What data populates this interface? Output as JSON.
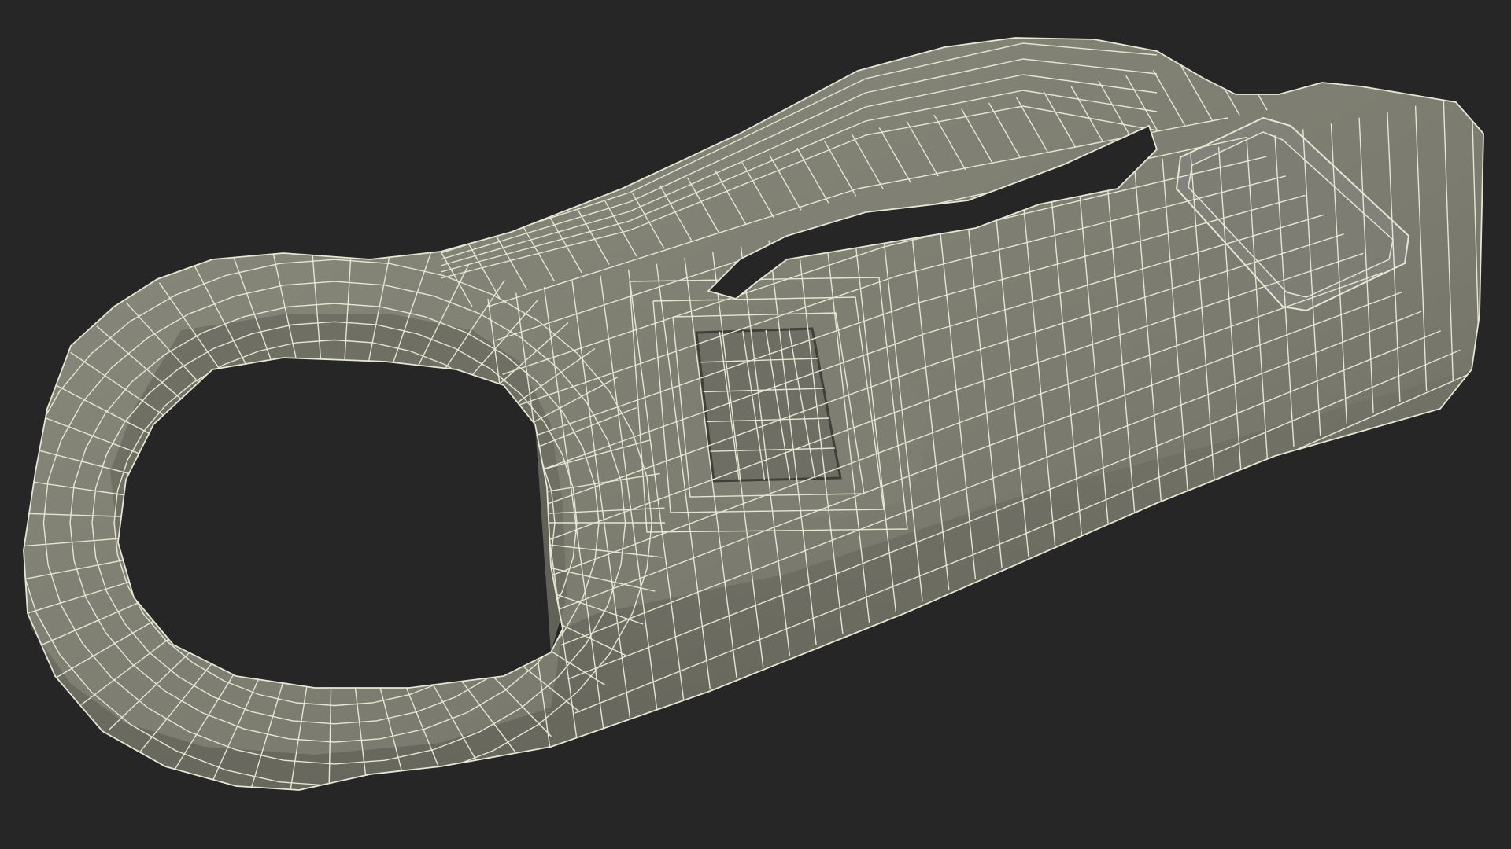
{
  "scene": {
    "subject": "wireframe-bottle-opener-keychain",
    "background_color": "#262626",
    "surface_color": "#7b7b6f",
    "surface_shadow_color": "#5f5f55",
    "surface_highlight_color": "#8a8a7d",
    "wire_color": "#e6e6d4",
    "hole_color": "#262626"
  }
}
